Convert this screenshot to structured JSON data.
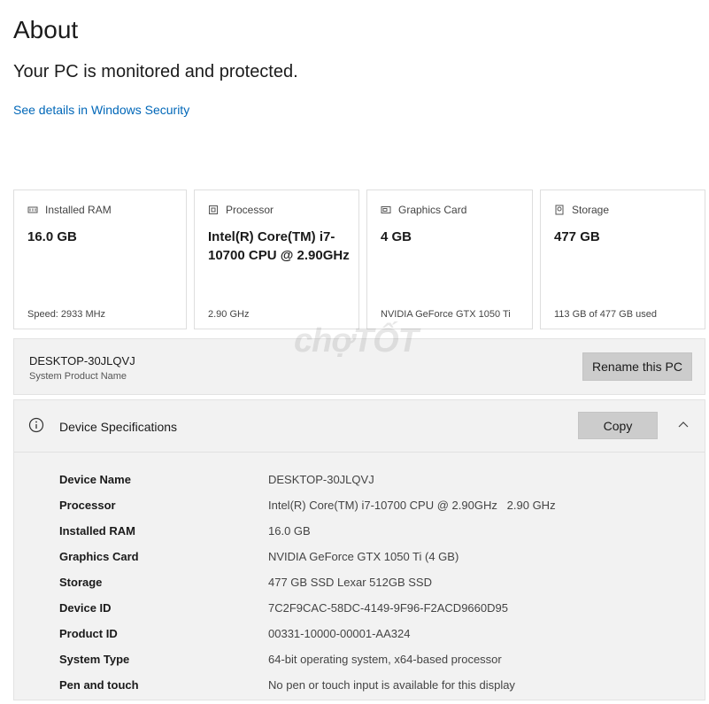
{
  "page": {
    "title": "About",
    "status": "Your PC is monitored and protected.",
    "security_link": "See details in Windows Security"
  },
  "cards": [
    {
      "icon": "ram-icon",
      "label": "Installed RAM",
      "value": "16.0 GB",
      "footer": "Speed: 2933 MHz"
    },
    {
      "icon": "processor-icon",
      "label": "Processor",
      "value": "Intel(R) Core(TM) i7-10700 CPU @ 2.90GHz",
      "footer": "2.90 GHz"
    },
    {
      "icon": "graphics-card-icon",
      "label": "Graphics Card",
      "value": "4 GB",
      "footer": "NVIDIA GeForce GTX 1050 Ti"
    },
    {
      "icon": "storage-icon",
      "label": "Storage",
      "value": "477 GB",
      "footer": "113 GB of 477 GB used"
    }
  ],
  "pc": {
    "name": "DESKTOP-30JLQVJ",
    "subtitle": "System Product Name",
    "rename_label": "Rename this PC"
  },
  "device_specs": {
    "title": "Device Specifications",
    "copy_label": "Copy",
    "rows": [
      {
        "key": "Device Name",
        "value": "DESKTOP-30JLQVJ"
      },
      {
        "key": "Processor",
        "value": "Intel(R) Core(TM) i7-10700 CPU @ 2.90GHz   2.90 GHz"
      },
      {
        "key": "Installed RAM",
        "value": "16.0 GB"
      },
      {
        "key": "Graphics Card",
        "value": "NVIDIA GeForce GTX 1050 Ti (4 GB)"
      },
      {
        "key": "Storage",
        "value": "477 GB SSD Lexar 512GB SSD"
      },
      {
        "key": "Device ID",
        "value": "7C2F9CAC-58DC-4149-9F96-F2ACD9660D95"
      },
      {
        "key": "Product ID",
        "value": "00331-10000-00001-AA324"
      },
      {
        "key": "System Type",
        "value": "64-bit operating system, x64-based processor"
      },
      {
        "key": "Pen and touch",
        "value": "No pen or touch input is available for this display"
      }
    ]
  },
  "watermark": "chợTỐT",
  "colors": {
    "link": "#0067b8",
    "panel": "#f2f2f2",
    "button": "#cccccc"
  }
}
